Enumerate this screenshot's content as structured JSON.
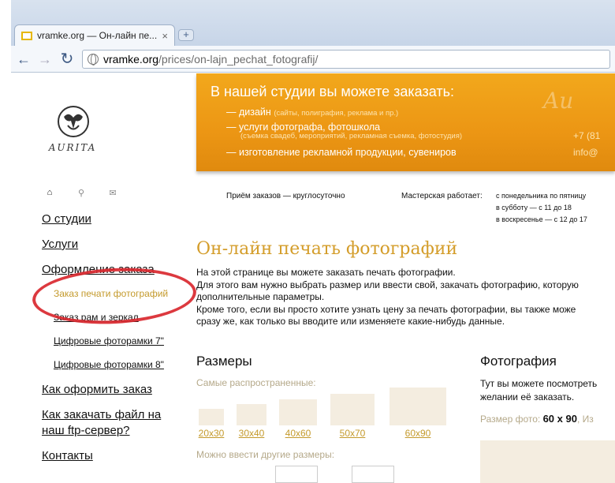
{
  "browser": {
    "tab_title": "vramke.org — Он-лайн пе...",
    "tab_close": "×",
    "new_tab": "+",
    "url_host": "vramke.org",
    "url_path": "/prices/on-lajn_pechat_fotografij/"
  },
  "logo": {
    "text": "AURITA"
  },
  "quick_icons": {
    "home": "⌂",
    "search": "⚲",
    "mail": "✉"
  },
  "nav": {
    "about": "О студии",
    "services": "Услуги",
    "order": "Оформление заказа",
    "sub_print": "Заказ печати фотографий",
    "sub_frames": "Заказ рам и зеркал",
    "sub_frames7": "Цифровые фоторамки 7\"",
    "sub_frames8": "Цифровые фоторамки 8\"",
    "how_to_order": "Как оформить заказ",
    "ftp_line1": "Как закачать файл на",
    "ftp_line2": "наш ftp-сервер?",
    "contacts": "Контакты"
  },
  "banner": {
    "title": "В нашей студии вы можете заказать:",
    "line1": "— дизайн",
    "line1_note": "(сайты, полиграфия, реклама и пр.)",
    "line2": "— услуги фотографа, фотошкола",
    "line2_note": "(съемка свадеб, мероприятий, рекламная съемка, фотостудия)",
    "line3": "— изготовление рекламной продукции, сувениров",
    "deco": "Au",
    "phone": "+7 (81",
    "mail": "info@"
  },
  "info": {
    "orders": "Приём заказов — круглосуточно",
    "workshop_label": "Мастерская работает:",
    "hours1": "с понедельника по пятницу",
    "hours2": "в субботу — с 11 до 18",
    "hours3": "в воскресенье — с 12 до 17"
  },
  "main": {
    "title": "Он-лайн печать фотографий",
    "intro1": "На этой странице вы можете заказать печать фотографии.",
    "intro2": "Для этого вам нужно выбрать размер или ввести свой, закачать фотографию, которую",
    "intro3": "дополнительные параметры.",
    "intro4": "Кроме того, если вы просто хотите узнать цену за печать фотографии, вы также може",
    "intro5": "сразу же, как только вы вводите или изменяете какие-нибудь данные."
  },
  "sizes": {
    "heading": "Размеры",
    "popular": "Самые распространенные:",
    "items": [
      "20х30",
      "30х40",
      "40х60",
      "50х70",
      "60х90"
    ],
    "custom": "Можно ввести другие размеры:"
  },
  "photo": {
    "heading": "Фотография",
    "text1": "Тут вы можете посмотреть",
    "text2": "желании её заказать.",
    "size_label": "Размер фото:",
    "size_value": "60 х 90",
    "size_tail": ", Из"
  }
}
